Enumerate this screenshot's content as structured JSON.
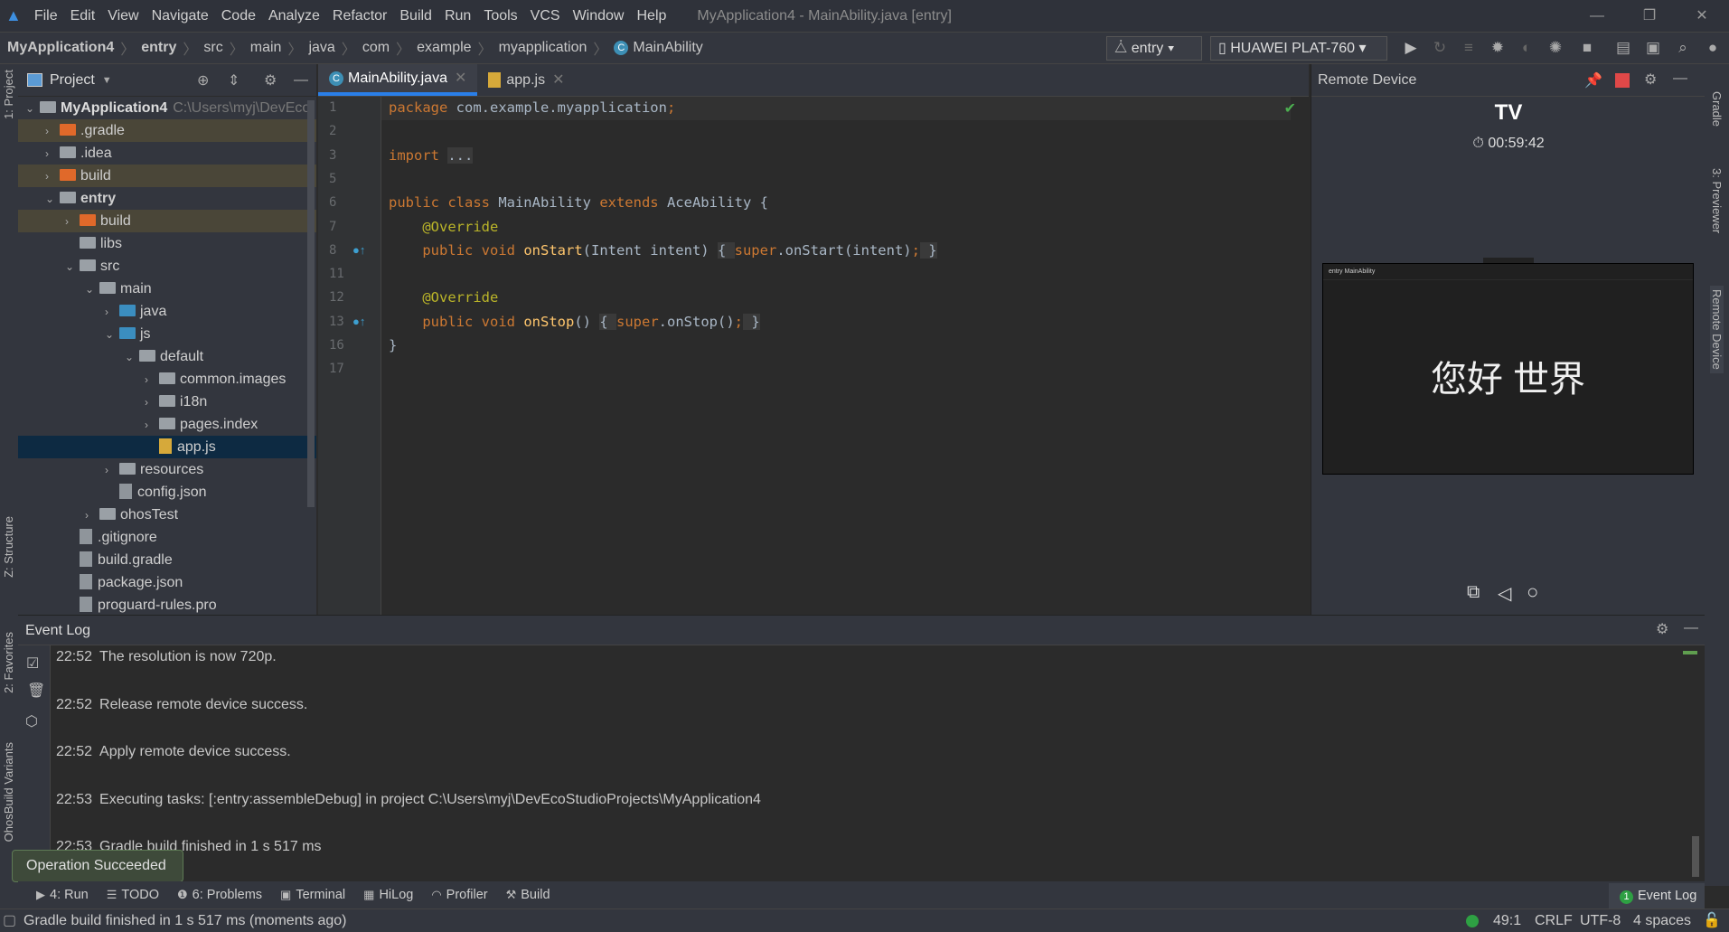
{
  "menubar": {
    "items": [
      "File",
      "Edit",
      "View",
      "Navigate",
      "Code",
      "Analyze",
      "Refactor",
      "Build",
      "Run",
      "Tools",
      "VCS",
      "Window",
      "Help"
    ],
    "title": "MyApplication4 - MainAbility.java [entry]"
  },
  "breadcrumb": [
    "MyApplication4",
    "entry",
    "src",
    "main",
    "java",
    "com",
    "example",
    "myapplication",
    "MainAbility"
  ],
  "toolbar": {
    "config": "entry",
    "device": "HUAWEI PLAT-760"
  },
  "project": {
    "title": "Project",
    "root_name": "MyApplication4",
    "root_path": "C:\\Users\\myj\\DevEco",
    "rows": [
      ".gradle",
      ".idea",
      "build",
      "entry",
      "build",
      "libs",
      "src",
      "main",
      "java",
      "js",
      "default",
      "common.images",
      "i18n",
      "pages.index",
      "app.js",
      "resources",
      "config.json",
      "ohosTest",
      ".gitignore",
      "build.gradle",
      "package.json",
      "proguard-rules.pro"
    ]
  },
  "left_strip": {
    "project": "1: Project",
    "structure": "Z: Structure",
    "favorites": "2: Favorites",
    "variants": "OhosBuild Variants"
  },
  "right_strip": {
    "gradle": "Gradle",
    "previewer": "3: Previewer",
    "remote": "Remote Device"
  },
  "tabs": [
    {
      "label": "MainAbility.java",
      "active": true
    },
    {
      "label": "app.js",
      "active": false
    }
  ],
  "editor": {
    "line_numbers": [
      "1",
      "2",
      "3",
      "5",
      "6",
      "7",
      "8",
      "11",
      "12",
      "13",
      "16",
      "17"
    ]
  },
  "remote": {
    "title": "Remote Device",
    "device": "TV",
    "timer": "00:59:42",
    "screen_title": "entry MainAbility",
    "screen_text": "您好 世界"
  },
  "event_log": {
    "title": "Event Log",
    "entries": [
      {
        "time": "22:52",
        "text": "The resolution is now 720p."
      },
      {
        "time": "22:52",
        "text": "Release remote device success."
      },
      {
        "time": "22:52",
        "text": "Apply remote device success."
      },
      {
        "time": "22:53",
        "text": "Executing tasks: [:entry:assembleDebug] in project C:\\Users\\myj\\DevEcoStudioProjects\\MyApplication4"
      },
      {
        "time": "22:53",
        "text": "Gradle build finished in 1 s 517 ms"
      }
    ]
  },
  "tooltip": "Operation Succeeded",
  "toolwindows": [
    "4: Run",
    "TODO",
    "6: Problems",
    "Terminal",
    "HiLog",
    "Profiler",
    "Build"
  ],
  "event_log_button": {
    "count": "1",
    "label": "Event Log"
  },
  "status": {
    "message": "Gradle build finished in 1 s 517 ms (moments ago)",
    "position": "49:1",
    "line_sep": "CRLF",
    "encoding": "UTF-8",
    "indent": "4 spaces"
  },
  "colors": {
    "accent": "#2a7fe8",
    "keyword": "#cc7832",
    "annotation": "#bbb529",
    "method": "#ffc66d",
    "success": "#2ea043"
  }
}
